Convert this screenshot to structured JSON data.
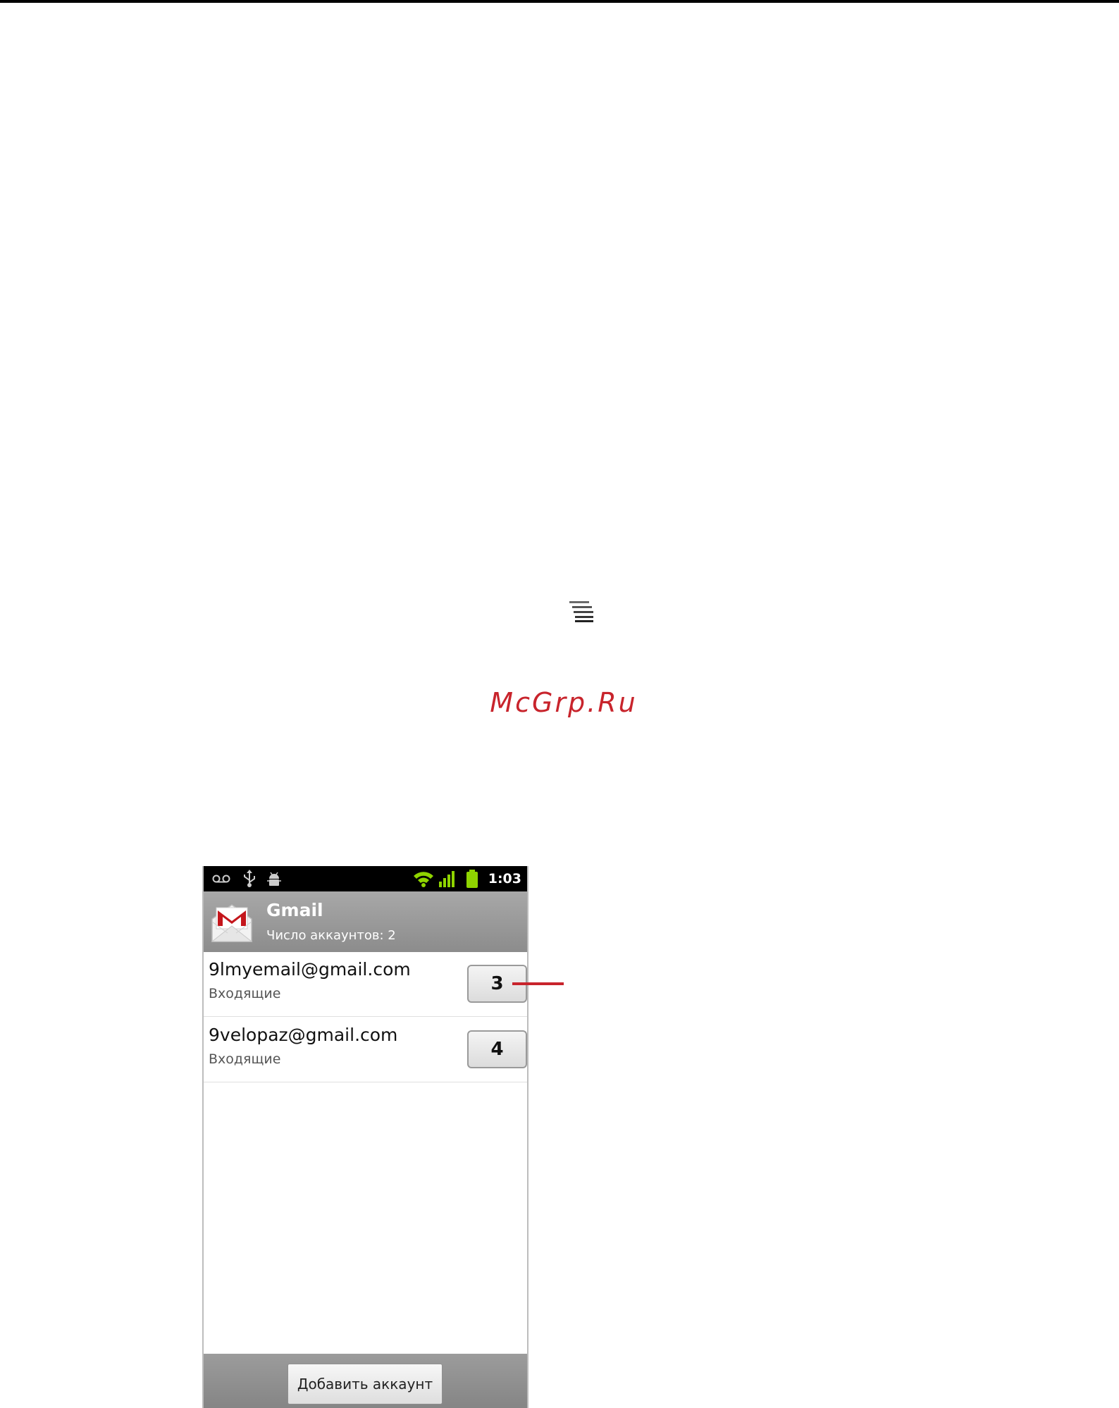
{
  "watermark": "McGrp.Ru",
  "icons": {
    "menu_key": "menu-key-icon",
    "status_left": [
      "voicemail-icon",
      "usb-icon",
      "android-debug-icon"
    ],
    "status_right": [
      "wifi-icon",
      "signal-icon",
      "battery-icon"
    ]
  },
  "phone": {
    "status_time": "1:03",
    "app": {
      "title": "Gmail",
      "subtitle": "Число аккаунтов: 2"
    },
    "accounts": [
      {
        "email": "9lmyemail@gmail.com",
        "folder": "Входящие",
        "count": "3"
      },
      {
        "email": "9velopaz@gmail.com",
        "folder": "Входящие",
        "count": "4"
      }
    ],
    "add_account_label": "Добавить аккаунт"
  },
  "colors": {
    "accent_red": "#c8242c",
    "header_gray": "#9a9a9a",
    "wifi_green": "#8fd400"
  }
}
